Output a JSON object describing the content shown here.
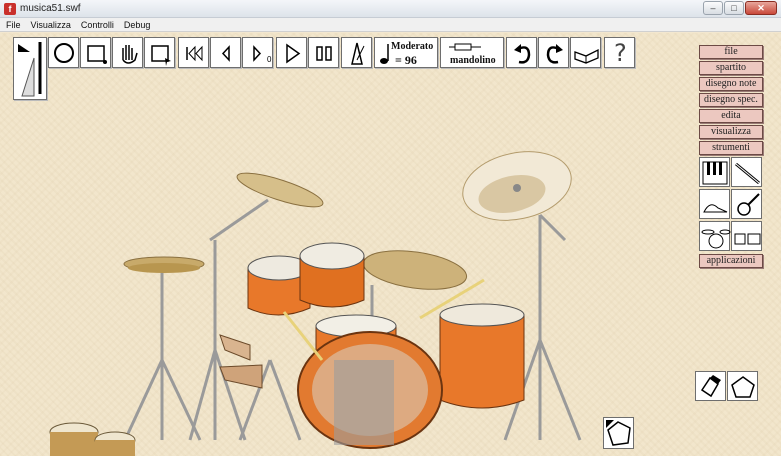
{
  "window": {
    "title": "musica51.swf",
    "app_icon": "flash-icon"
  },
  "menu": [
    "File",
    "Visualizza",
    "Controlli",
    "Debug"
  ],
  "toolbar": {
    "tempo_label": "Moderato",
    "tempo_value": "= 96",
    "instrument_label": "mandolino",
    "step_counter": "0",
    "help_glyph": "?"
  },
  "side_menu": [
    "file",
    "spartito",
    "disegno note",
    "disegno spec.",
    "edita",
    "visualizza",
    "strumenti",
    "applicazioni"
  ],
  "instruments": [
    "piano-icon",
    "flute-icon",
    "harp-icon",
    "guitar-icon",
    "drum-kit-icon",
    "percussion-icon"
  ],
  "colors": {
    "button_pink": "#ecc8c0",
    "background": "#f2e6cc",
    "drum_orange": "#e8782a"
  }
}
